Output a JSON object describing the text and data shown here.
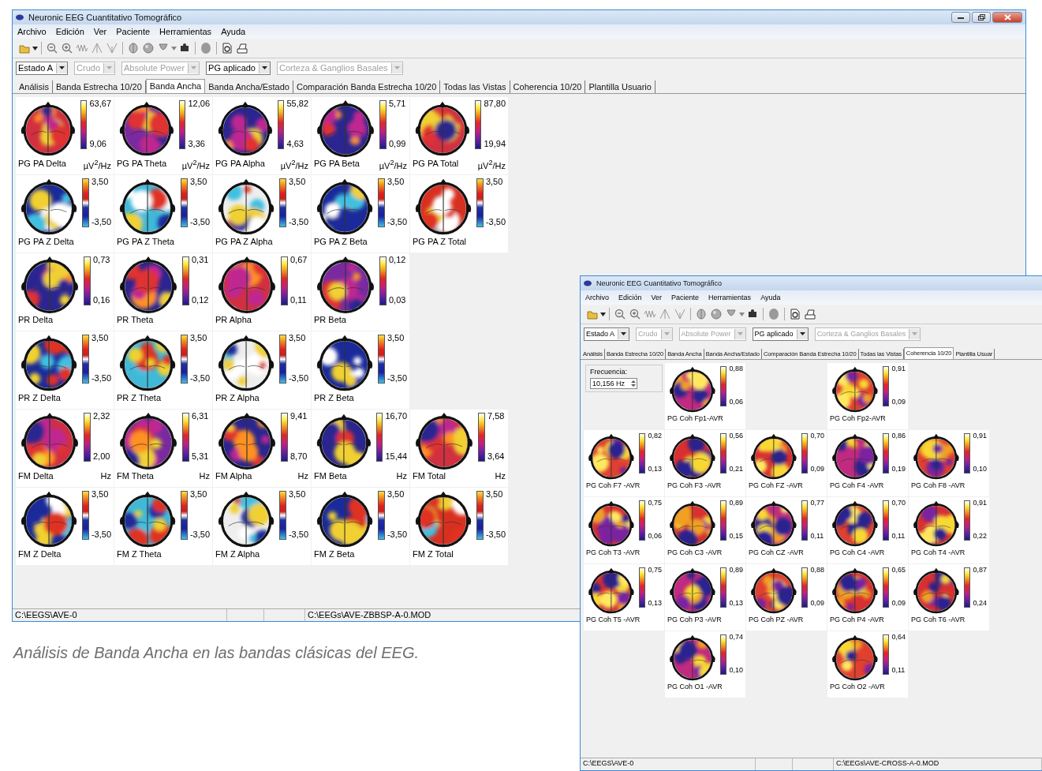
{
  "windows": [
    {
      "title": "Neuronic EEG Cuantitativo Tomográfico",
      "controls": true,
      "menu": [
        "Archivo",
        "Edición",
        "Ver",
        "Paciente",
        "Herramientas",
        "Ayuda"
      ],
      "combos": [
        {
          "value": "Estado A",
          "disabled": false
        },
        {
          "value": "Crudo",
          "disabled": true
        },
        {
          "value": "Absolute Power",
          "disabled": true
        },
        {
          "value": "PG aplicado",
          "disabled": false
        },
        {
          "value": "Corteza & Ganglios Basales",
          "disabled": true
        }
      ],
      "tabs": [
        {
          "label": "Análisis",
          "selected": false
        },
        {
          "label": "Banda Estrecha 10/20",
          "selected": false
        },
        {
          "label": "Banda Ancha",
          "selected": true
        },
        {
          "label": "Banda Ancha/Estado",
          "selected": false
        },
        {
          "label": "Comparación Banda Estrecha 10/20",
          "selected": false
        },
        {
          "label": "Todas las Vistas",
          "selected": false
        },
        {
          "label": "Coherencia 10/20",
          "selected": false
        },
        {
          "label": "Plantilla Usuario",
          "selected": false
        }
      ],
      "maps": [
        [
          {
            "label": "PG PA Delta",
            "max": "63,67",
            "min": "9,06",
            "unit": "µV$^{2}$/Hz",
            "kind": "power"
          },
          {
            "label": "PG PA Theta",
            "max": "12,06",
            "min": "3,36",
            "unit": "µV$^{2}$/Hz",
            "kind": "power"
          },
          {
            "label": "PG PA Alpha",
            "max": "55,82",
            "min": "4,63",
            "unit": "µV$^{2}$/Hz",
            "kind": "power"
          },
          {
            "label": "PG PA Beta",
            "max": "5,71",
            "min": "0,99",
            "unit": "µV$^{2}$/Hz",
            "kind": "power"
          },
          {
            "label": "PG PA Total",
            "max": "87,80",
            "min": "19,94",
            "unit": "µV$^{2}$/Hz",
            "kind": "power"
          }
        ],
        [
          {
            "label": "PG PA Z Delta",
            "max": "3,50",
            "min": "-3,50",
            "kind": "z"
          },
          {
            "label": "PG PA Z Theta",
            "max": "3,50",
            "min": "-3,50",
            "kind": "z"
          },
          {
            "label": "PG PA Z Alpha",
            "max": "3,50",
            "min": "-3,50",
            "kind": "z"
          },
          {
            "label": "PG PA Z Beta",
            "max": "3,50",
            "min": "-3,50",
            "kind": "z"
          },
          {
            "label": "PG PA Z Total",
            "max": "3,50",
            "min": "-3,50",
            "kind": "z"
          }
        ],
        [
          {
            "label": "PR Delta",
            "max": "0,73",
            "min": "0,16",
            "kind": "power"
          },
          {
            "label": "PR Theta",
            "max": "0,31",
            "min": "0,12",
            "kind": "power"
          },
          {
            "label": "PR Alpha",
            "max": "0,67",
            "min": "0,11",
            "kind": "power"
          },
          {
            "label": "PR Beta",
            "max": "0,12",
            "min": "0,03",
            "kind": "power"
          }
        ],
        [
          {
            "label": "PR Z Delta",
            "max": "3,50",
            "min": "-3,50",
            "kind": "z"
          },
          {
            "label": "PR Z Theta",
            "max": "3,50",
            "min": "-3,50",
            "kind": "z"
          },
          {
            "label": "PR Z Alpha",
            "max": "3,50",
            "min": "-3,50",
            "kind": "z"
          },
          {
            "label": "PR Z Beta",
            "max": "3,50",
            "min": "-3,50",
            "kind": "z"
          }
        ],
        [
          {
            "label": "FM Delta",
            "max": "2,32",
            "min": "2,00",
            "unit": "Hz",
            "kind": "power"
          },
          {
            "label": "FM Theta",
            "max": "6,31",
            "min": "5,31",
            "unit": "Hz",
            "kind": "power"
          },
          {
            "label": "FM Alpha",
            "max": "9,41",
            "min": "8,70",
            "unit": "Hz",
            "kind": "power"
          },
          {
            "label": "FM Beta",
            "max": "16,70",
            "min": "15,44",
            "unit": "Hz",
            "kind": "power"
          },
          {
            "label": "FM Total",
            "max": "7,58",
            "min": "3,64",
            "unit": "Hz",
            "kind": "power"
          }
        ],
        [
          {
            "label": "FM Z Delta",
            "max": "3,50",
            "min": "-3,50",
            "kind": "z"
          },
          {
            "label": "FM Z Theta",
            "max": "3,50",
            "min": "-3,50",
            "kind": "z"
          },
          {
            "label": "FM Z Alpha",
            "max": "3,50",
            "min": "-3,50",
            "kind": "z"
          },
          {
            "label": "FM Z Beta",
            "max": "3,50",
            "min": "-3,50",
            "kind": "z"
          },
          {
            "label": "FM Z Total",
            "max": "3,50",
            "min": "-3,50",
            "kind": "z"
          }
        ]
      ],
      "status_bar": [
        "C:\\EEGS\\AVE-0",
        "C:\\EEGs\\AVE-ZBBSP-A-0.MOD"
      ]
    },
    {
      "title": "Neuronic EEG Cuantitativo Tomográfico",
      "controls": false,
      "menu": [
        "Archivo",
        "Edición",
        "Ver",
        "Paciente",
        "Herramientas",
        "Ayuda"
      ],
      "combos": [
        {
          "value": "Estado A",
          "disabled": false
        },
        {
          "value": "Crudo",
          "disabled": true
        },
        {
          "value": "Absolute Power",
          "disabled": true
        },
        {
          "value": "PG aplicado",
          "disabled": false
        },
        {
          "value": "Corteza & Ganglios Basales",
          "disabled": true
        }
      ],
      "tabs": [
        {
          "label": "Análisis",
          "selected": false
        },
        {
          "label": "Banda Estrecha 10/20",
          "selected": false
        },
        {
          "label": "Banda Ancha",
          "selected": false
        },
        {
          "label": "Banda Ancha/Estado",
          "selected": false
        },
        {
          "label": "Comparación Banda Estrecha 10/20",
          "selected": false
        },
        {
          "label": "Todas las Vistas",
          "selected": false
        },
        {
          "label": "Coherencia 10/20",
          "selected": true
        },
        {
          "label": "Plantilla Usuar",
          "selected": false
        }
      ],
      "frequency": {
        "label": "Frecuencia:",
        "value": "10,156 Hz"
      },
      "maps": [
        [
          {
            "label": "PG Coh Fp1-AVR",
            "max": "0,88",
            "min": "0,06",
            "kind": "coherence"
          },
          {
            "label": "PG Coh Fp2-AVR",
            "max": "0,91",
            "min": "0,09",
            "kind": "coherence"
          }
        ],
        [
          {
            "label": "PG Coh F7 -AVR",
            "max": "0,82",
            "min": "0,13",
            "kind": "coherence"
          },
          {
            "label": "PG Coh F3 -AVR",
            "max": "0,56",
            "min": "0,21",
            "kind": "coherence"
          },
          {
            "label": "PG Coh FZ -AVR",
            "max": "0,70",
            "min": "0,09",
            "kind": "coherence"
          },
          {
            "label": "PG Coh F4 -AVR",
            "max": "0,86",
            "min": "0,19",
            "kind": "coherence"
          },
          {
            "label": "PG Coh F8 -AVR",
            "max": "0,91",
            "min": "0,10",
            "kind": "coherence"
          }
        ],
        [
          {
            "label": "PG Coh T3 -AVR",
            "max": "0,75",
            "min": "0,06",
            "kind": "coherence"
          },
          {
            "label": "PG Coh C3 -AVR",
            "max": "0,89",
            "min": "0,15",
            "kind": "coherence"
          },
          {
            "label": "PG Coh CZ -AVR",
            "max": "0,77",
            "min": "0,11",
            "kind": "coherence"
          },
          {
            "label": "PG Coh C4 -AVR",
            "max": "0,70",
            "min": "0,11",
            "kind": "coherence"
          },
          {
            "label": "PG Coh T4 -AVR",
            "max": "0,91",
            "min": "0,22",
            "kind": "coherence"
          }
        ],
        [
          {
            "label": "PG Coh T5 -AVR",
            "max": "0,75",
            "min": "0,13",
            "kind": "coherence"
          },
          {
            "label": "PG Coh P3 -AVR",
            "max": "0,89",
            "min": "0,13",
            "kind": "coherence"
          },
          {
            "label": "PG Coh PZ -AVR",
            "max": "0,88",
            "min": "0,09",
            "kind": "coherence"
          },
          {
            "label": "PG Coh P4 -AVR",
            "max": "0,65",
            "min": "0,09",
            "kind": "coherence"
          },
          {
            "label": "PG Coh T6 -AVR",
            "max": "0,87",
            "min": "0,24",
            "kind": "coherence"
          }
        ],
        [
          {
            "label": "PG Coh O1 -AVR",
            "max": "0,74",
            "min": "0,10",
            "kind": "coherence"
          },
          {
            "label": "PG Coh O2 -AVR",
            "max": "0,64",
            "min": "0,11",
            "kind": "coherence"
          }
        ]
      ],
      "status_bar": [
        "C:\\EEGS\\AVE-0",
        "C:\\EEGs\\AVE-CROSS-A-0.MOD"
      ]
    }
  ],
  "caption": "Análisis de Banda Ancha en las bandas clásicas del EEG."
}
